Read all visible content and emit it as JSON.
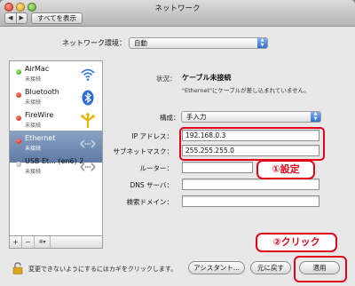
{
  "window": {
    "title": "ネットワーク"
  },
  "toolbar": {
    "back": "◀",
    "forward": "▶",
    "show_all": "すべてを表示"
  },
  "location": {
    "label": "ネットワーク環境：",
    "value": "自動"
  },
  "services": [
    {
      "name": "AirMac",
      "status": "未接続",
      "dot": "green",
      "icon": "wifi-icon"
    },
    {
      "name": "Bluetooth",
      "status": "未接続",
      "dot": "red",
      "icon": "bluetooth-icon"
    },
    {
      "name": "FireWire",
      "status": "未接続",
      "dot": "red",
      "icon": "firewire-icon"
    },
    {
      "name": "Ethernet",
      "status": "未接続",
      "dot": "red",
      "icon": "ethernet-icon",
      "selected": true
    },
    {
      "name": "USB Et... (en6) 2",
      "status": "未接続",
      "dot": "gray",
      "icon": "ethernet-icon"
    }
  ],
  "sidebar_toolbar": {
    "add": "+",
    "remove": "−",
    "action": "✲▾"
  },
  "status": {
    "label": "状況：",
    "value": "ケーブル未接続",
    "description": "\"Ethernet\"にケーブルが差し込まれていません。"
  },
  "configure": {
    "label": "構成：",
    "value": "手入力"
  },
  "fields": {
    "ip_label": "IP アドレス：",
    "ip_value": "192.168.0.3",
    "subnet_label": "サブネットマスク：",
    "subnet_value": "255.255.255.0",
    "router_label": "ルーター：",
    "router_value": "",
    "dns_label": "DNS サーバ：",
    "dns_value": "",
    "search_label": "検索ドメイン：",
    "search_value": ""
  },
  "annotations": {
    "step1": "①設定",
    "step2": "②クリック"
  },
  "bottom": {
    "lock_text": "変更できないようにするにはカギをクリックします。",
    "assist": "アシスタント...",
    "revert": "元に戻す",
    "apply": "適用"
  },
  "colors": {
    "annotation_red": "#e2001a",
    "selection": "#6f8ab3"
  }
}
